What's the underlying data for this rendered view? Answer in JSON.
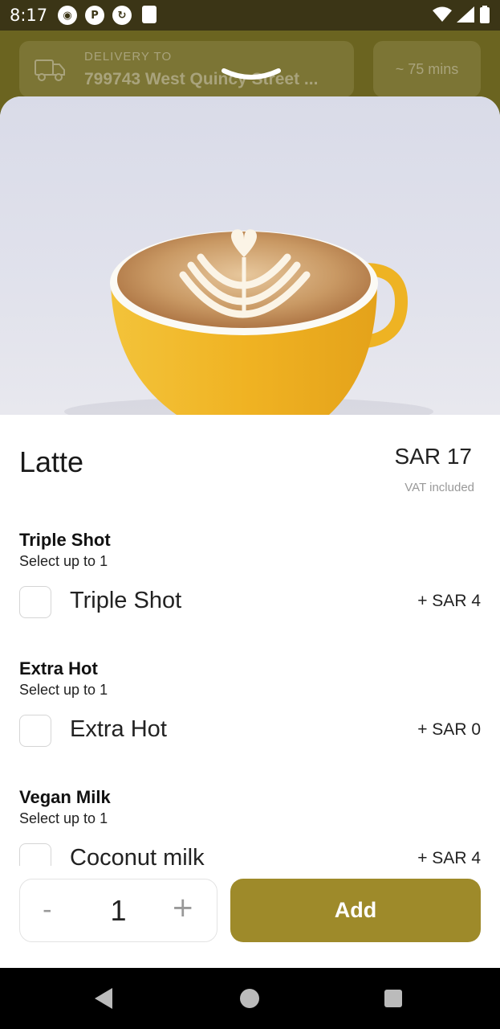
{
  "status_bar": {
    "time": "8:17"
  },
  "header": {
    "delivery_label": "DELIVERY TO",
    "delivery_address": "799743 West Quincy Street ...",
    "eta": "~ 75 mins"
  },
  "product": {
    "name": "Latte",
    "price": "SAR 17",
    "vat_note": "VAT included"
  },
  "option_groups": [
    {
      "title": "Triple Shot",
      "subtitle": "Select up to 1",
      "options": [
        {
          "label": "Triple Shot",
          "price": "+  SAR 4"
        }
      ]
    },
    {
      "title": "Extra Hot",
      "subtitle": "Select up to 1",
      "options": [
        {
          "label": "Extra Hot",
          "price": "+  SAR 0"
        }
      ]
    },
    {
      "title": "Vegan Milk",
      "subtitle": "Select up to 1",
      "options": [
        {
          "label": "Coconut milk",
          "price": "+  SAR 4"
        }
      ]
    }
  ],
  "quantity": {
    "minus": "-",
    "value": "1",
    "plus": "+"
  },
  "add_button": {
    "label": "Add"
  },
  "colors": {
    "accent": "#9e8a2a",
    "status_bar": "#3b3516",
    "cup": "#f0b323"
  },
  "icons": {
    "delivery": "truck-icon",
    "collapse": "chevron-down-icon"
  }
}
